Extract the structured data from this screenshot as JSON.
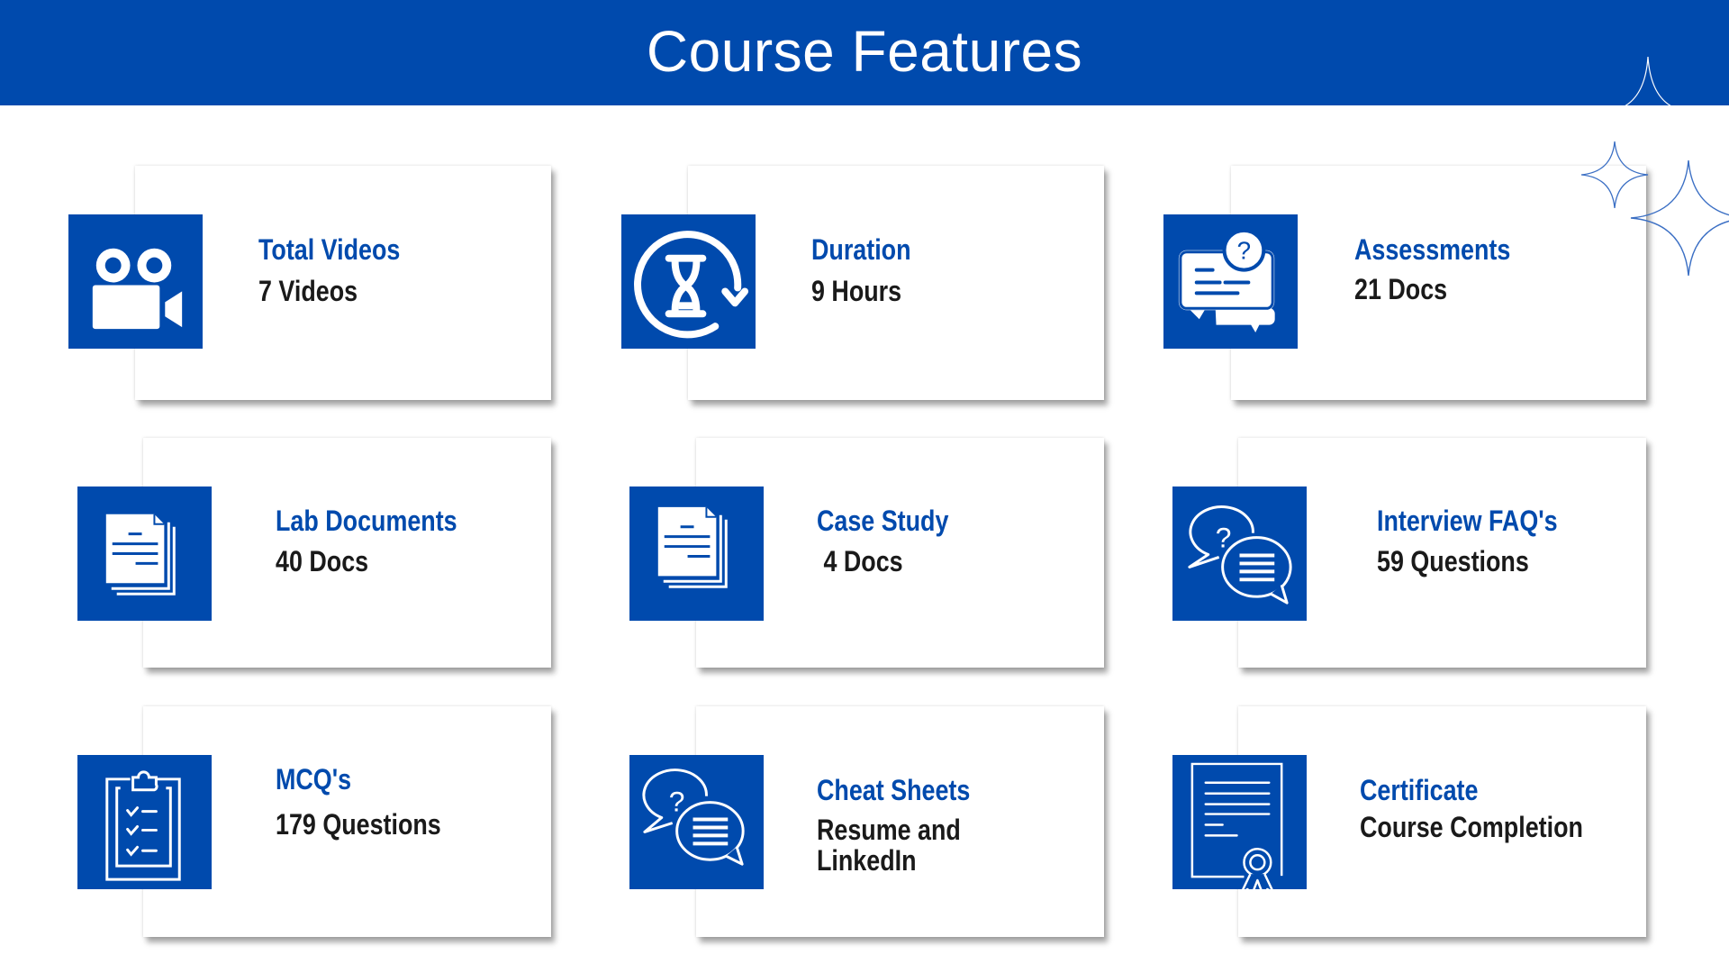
{
  "header": {
    "title": "Course Features",
    "background_color": "#004AAD"
  },
  "features": [
    {
      "title": "Total Videos",
      "value": "7 Videos",
      "icon": "video-camera-icon"
    },
    {
      "title": "Duration",
      "value": "9 Hours",
      "icon": "hourglass-refresh-icon"
    },
    {
      "title": "Assessments",
      "value": "21 Docs",
      "icon": "question-chat-icon"
    },
    {
      "title": "Lab Documents",
      "value": "40 Docs",
      "icon": "documents-icon"
    },
    {
      "title": "Case Study",
      "value": " 4 Docs",
      "icon": "documents-icon"
    },
    {
      "title": "Interview FAQ's",
      "value": "59 Questions",
      "icon": "question-chat-bubbles-icon"
    },
    {
      "title": "MCQ's",
      "value": "179 Questions",
      "icon": "clipboard-checklist-icon"
    },
    {
      "title": "Cheat Sheets",
      "value": "Resume and",
      "value_line2": "LinkedIn",
      "icon": "question-chat-bubbles-icon"
    },
    {
      "title": "Certificate",
      "value": "Course Completion",
      "icon": "certificate-icon"
    }
  ],
  "colors": {
    "accent": "#004AAD",
    "text_dark": "#1a1a1a",
    "card_bg": "#ffffff"
  }
}
